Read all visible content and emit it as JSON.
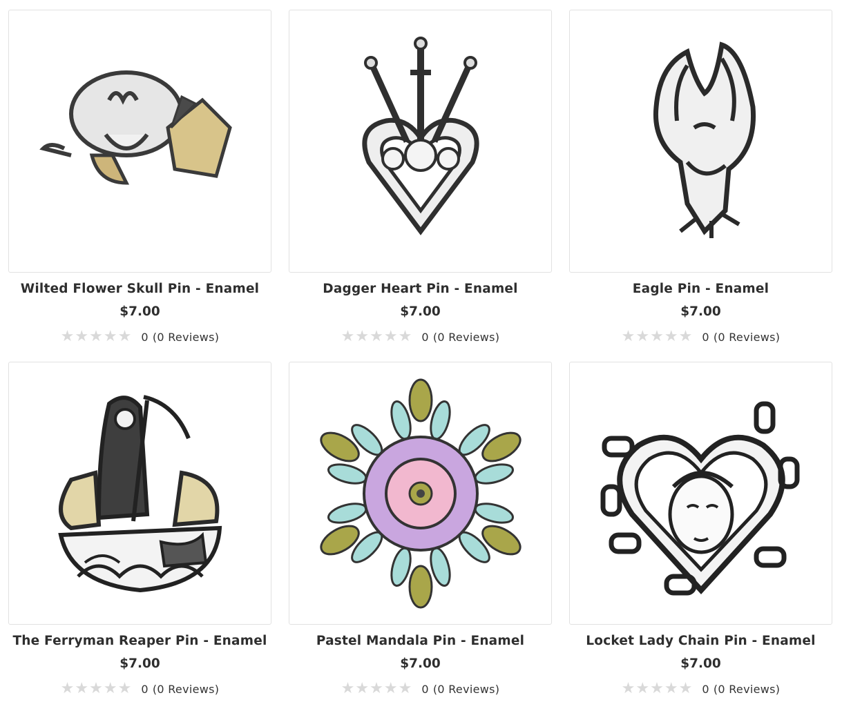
{
  "products": [
    {
      "title": "Wilted Flower Skull Pin - Enamel",
      "price": "$7.00",
      "rating": "0",
      "reviews": "(0 Reviews)",
      "image_icon": "wilted-flower-skull-pin-image"
    },
    {
      "title": "Dagger Heart Pin - Enamel",
      "price": "$7.00",
      "rating": "0",
      "reviews": "(0 Reviews)",
      "image_icon": "dagger-heart-pin-image"
    },
    {
      "title": "Eagle Pin - Enamel",
      "price": "$7.00",
      "rating": "0",
      "reviews": "(0 Reviews)",
      "image_icon": "eagle-pin-image"
    },
    {
      "title": "The Ferryman Reaper Pin - Enamel",
      "price": "$7.00",
      "rating": "0",
      "reviews": "(0 Reviews)",
      "image_icon": "ferryman-reaper-pin-image"
    },
    {
      "title": "Pastel Mandala Pin - Enamel",
      "price": "$7.00",
      "rating": "0",
      "reviews": "(0 Reviews)",
      "image_icon": "pastel-mandala-pin-image"
    },
    {
      "title": "Locket Lady Chain Pin - Enamel",
      "price": "$7.00",
      "rating": "0",
      "reviews": "(0 Reviews)",
      "image_icon": "locket-lady-chain-pin-image"
    }
  ],
  "colors": {
    "border": "#e1e1e1",
    "star_empty": "#d9d9d9",
    "text": "#2e2e2e",
    "silver": "#c9c9c9",
    "gold": "#d8c48a",
    "mandala_purple": "#c9a6df",
    "mandala_teal": "#a8dcd9",
    "mandala_olive": "#a9a64a",
    "mandala_pink": "#f2b8cf"
  }
}
